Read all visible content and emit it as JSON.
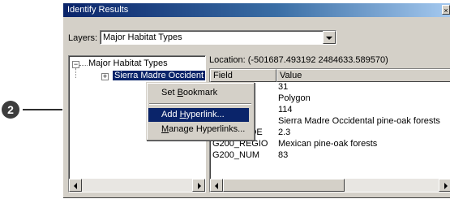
{
  "window": {
    "title": "Identify Results",
    "close_glyph": "×"
  },
  "layers": {
    "label": "Layers:",
    "selected": "Major Habitat Types"
  },
  "tree": {
    "root_label": "Major Habitat Types",
    "child_label": "Sierra Madre Occident",
    "root_toggle": "−",
    "child_toggle": "+"
  },
  "location": {
    "text": "Location: (-501687.493192  2484633.589570)"
  },
  "table": {
    "headers": {
      "field": "Field",
      "value": "Value"
    },
    "rows": [
      {
        "field": "",
        "value": "31"
      },
      {
        "field": "",
        "value": "Polygon"
      },
      {
        "field": "",
        "value": "114"
      },
      {
        "field": "",
        "value": "Sierra Madre Occidental pine-oak forests"
      },
      {
        "field": "MHT_CODE",
        "value": "2.3"
      },
      {
        "field": "G200_REGIO",
        "value": "Mexican pine-oak forests"
      },
      {
        "field": "G200_NUM",
        "value": "83"
      }
    ]
  },
  "context_menu": {
    "items": [
      {
        "pre": "Set ",
        "u": "B",
        "post": "ookmark"
      },
      {
        "pre": "Add ",
        "u": "H",
        "post": "yperlink..."
      },
      {
        "pre": "",
        "u": "M",
        "post": "anage Hyperlinks..."
      }
    ],
    "selected_index": 1
  },
  "callout": {
    "number": "2"
  },
  "colors": {
    "accent": "#0a246a",
    "callout": "#3d3d3d"
  }
}
